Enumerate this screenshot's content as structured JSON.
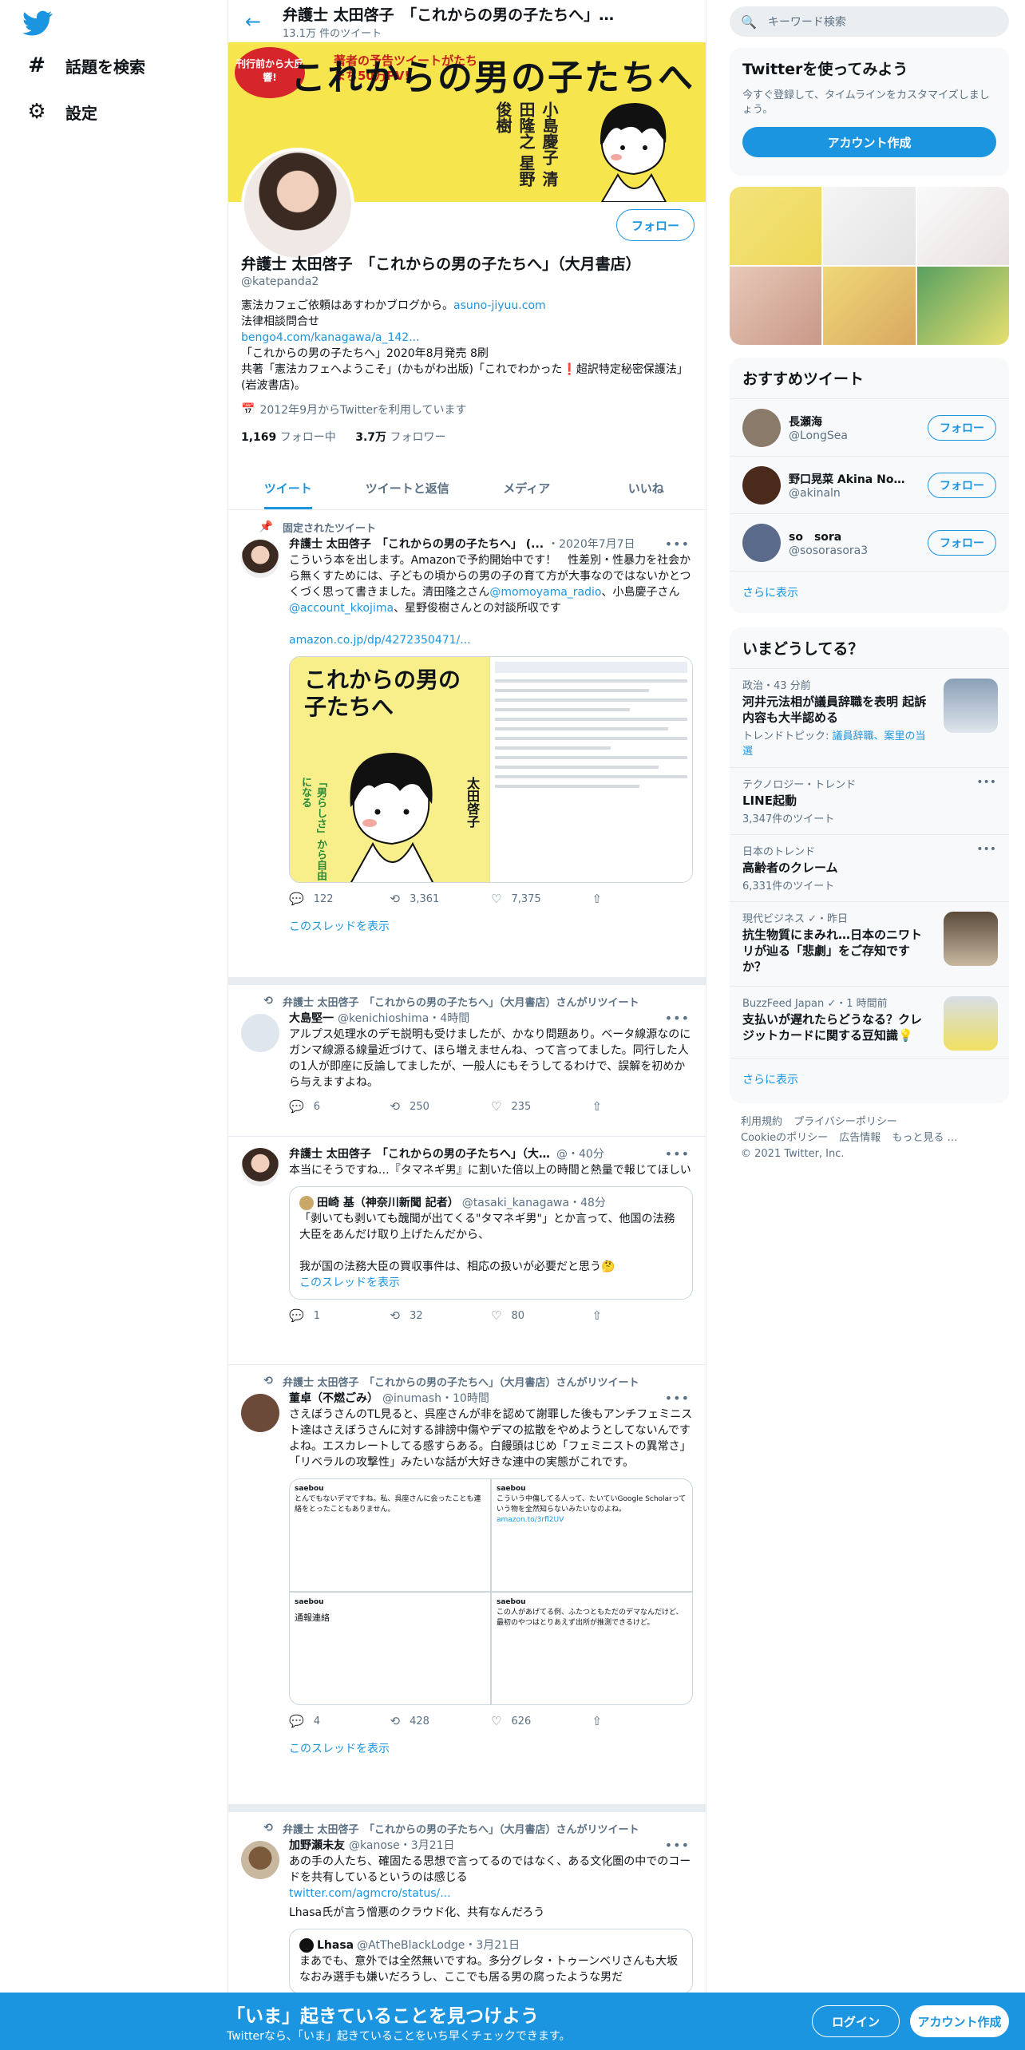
{
  "nav": {
    "explore_label": "話題を検索",
    "settings_label": "設定"
  },
  "header": {
    "title": "弁護士 太田啓子　「これからの男の子たちへ」…",
    "tweet_count": "13.1万 件のツイート"
  },
  "banner": {
    "badge": "刊行前から大反響!",
    "title": "これからの男の子たちへ",
    "promo": "著者の予告ツイートがたちまち50万PV!",
    "names": "小島慶子 清田隆之 星野俊樹"
  },
  "profile": {
    "follow_label": "フォロー",
    "name": "弁護士 太田啓子　「これからの男の子たちへ」（大月書店）",
    "handle": "@katepanda2",
    "bio_line1": "憲法カフェご依頼はあすわかブログから。",
    "bio_link1": "asuno-jiyuu.com",
    "bio_line2": "法律相談問合せ",
    "bio_link2": "bengo4.com/kanagawa/a_142...",
    "bio_line3": "「これからの男の子たちへ」2020年8月発売 8刷",
    "bio_line4": "共著「憲法カフェへようこそ」(かもがわ出版)「これでわかった❗超訳特定秘密保護法」(岩波書店)。",
    "joined": "2012年9月からTwitterを利用しています",
    "following_count": "1,169",
    "following_label": "フォロー中",
    "followers_count": "3.7万",
    "followers_label": "フォロワー"
  },
  "tabs": [
    "ツイート",
    "ツイートと返信",
    "メディア",
    "いいね"
  ],
  "tweets": [
    {
      "context": "固定されたツイート",
      "name": "弁護士 太田啓子　「これからの男の子たちへ」 (...",
      "handle": "・2020年7月7日",
      "text_a": "こういう本を出します。Amazonで予約開始中です！　性差別・性暴力を社会から無くすためには、子どもの頃からの男の子の育て方が大事なのではないかとつくづく思って書きました。清田隆之さん",
      "mention1": "@momoyama_radio",
      "text_b": "、小島慶子さん",
      "mention2": "@account_kkojima",
      "text_c": "、星野俊樹さんとの対談所収です",
      "link": "amazon.co.jp/dp/4272350471/...",
      "media_title": "これからの男の子たちへ",
      "media_author": "太田啓子",
      "media_side": "「男らしさ」から自由になる",
      "replies": "122",
      "retweets": "3,361",
      "likes": "7,375",
      "show_thread": "このスレッドを表示"
    },
    {
      "context": "弁護士 太田啓子　「これからの男の子たちへ」（大月書店）さんがリツイート",
      "name": "大島堅一",
      "handle": "@kenichioshima・4時間",
      "text": "アルプス処理水のデモ説明も受けましたが、かなり問題あり。ベータ線源なのにガンマ線源る線量近づけて、ほら増えませんね、って言ってました。同行した人の1人が即座に反論してましたが、一般人にもそうしてるわけで、誤解を初めから与えますよね。",
      "replies": "6",
      "retweets": "250",
      "likes": "235"
    },
    {
      "name": "弁護士 太田啓子　「これからの男の子たちへ」（大月書店）",
      "handle": "@・40分",
      "text": "本当にそうですね…『タマネギ男』に割いた倍以上の時間と熱量で報じてほしい",
      "quote_name": "田崎 基（神奈川新聞 記者）",
      "quote_handle": "@tasaki_kanagawa・48分",
      "quote_text1": "「剥いても剥いても醜聞が出てくる\"タマネギ男\"」とか言って、他国の法務大臣をあんだけ取り上げたんだから、",
      "quote_text2": "我が国の法務大臣の買収事件は、相応の扱いが必要だと思う🤔",
      "quote_thread": "このスレッドを表示",
      "replies": "1",
      "retweets": "32",
      "likes": "80"
    },
    {
      "context": "弁護士 太田啓子　「これからの男の子たちへ」（大月書店）さんがリツイート",
      "name": "董卓（不燃ごみ）",
      "handle": "@inumash・10時間",
      "text": "さえぼうさんのTL見ると、呉座さんが非を認めて謝罪した後もアンチフェミニスト達はさえぼうさんに対する誹謗中傷やデマの拡散をやめようとしてないんですよね。エスカレートしてる感すらある。白饅頭はじめ「フェミニストの異常さ」「リベラルの攻撃性」みたいな話が大好きな連中の実態がこれです。",
      "shot1_name": "saebou",
      "shot1_text": "とんでもないデマですね。私、呉座さんに会ったことも連絡をとったこともありません。",
      "shot2_name": "saebou",
      "shot2_text": "こういう中傷してる人って、たいていGoogle Scholarっていう物を全然知らないみたいなのよね。",
      "shot2_link": "amazon.to/3rfl2UV",
      "shot3_name": "saebou",
      "shot3_text": "通報連絡",
      "shot4_name": "saebou",
      "shot4_text": "この人があげてる例、ふたつともただのデマなんだけど、最初のやつはとりあえず出所が推測できるけど。",
      "replies": "4",
      "retweets": "428",
      "likes": "626",
      "show_thread": "このスレッドを表示"
    },
    {
      "context": "弁護士 太田啓子　「これからの男の子たちへ」（大月書店）さんがリツイート",
      "name": "加野瀬未友",
      "handle": "@kanose・3月21日",
      "text": "あの手の人たち、確固たる思想で言ってるのではなく、ある文化圏の中でのコードを共有しているというのは感じる",
      "link": "twitter.com/agmcro/status/...",
      "text2": "Lhasa氏が言う憎悪のクラウド化、共有なんだろう",
      "quote_name": "Lhasa",
      "quote_handle": "@AtTheBlackLodge・3月21日",
      "quote_text": "まあでも、意外では全然無いですね。多分グレタ・トゥーンベリさんも大坂なおみ選手も嫌いだろうし、ここでも居る男の腐ったような男だ"
    }
  ],
  "search": {
    "placeholder": "キーワード検索"
  },
  "signup": {
    "title": "Twitterを使ってみよう",
    "desc": "今すぐ登録して、タイムラインをカスタマイズしましょう。",
    "button": "アカウント作成"
  },
  "who_to_follow": {
    "title": "おすすめツイート",
    "items": [
      {
        "name": "長瀬海",
        "handle": "@LongSea",
        "button": "フォロー"
      },
      {
        "name": "野口晃菜 Akina Nog...",
        "handle": "@akinaln",
        "button": "フォロー"
      },
      {
        "name": "so　sora",
        "handle": "@sosorasora3",
        "button": "フォロー"
      }
    ],
    "more": "さらに表示"
  },
  "trends": {
    "title": "いまどうしてる？",
    "items": [
      {
        "top": "政治・43 分前",
        "title": "河井元法相が議員辞職を表明 起訴内容も大半認める",
        "bottom_prefix": "トレンドトピック: ",
        "bottom_link": "議員辞職、案里の当選"
      },
      {
        "top": "テクノロジー・トレンド",
        "title": "LINE起動",
        "bottom": "3,347件のツイート"
      },
      {
        "top": "日本のトレンド",
        "title": "高齢者のクレーム",
        "bottom": "6,331件のツイート"
      },
      {
        "top": "現代ビジネス ✓・昨日",
        "title": "抗生物質にまみれ…日本のニワトリが辿る「悲劇」をご存知ですか？"
      },
      {
        "top": "BuzzFeed Japan ✓・1 時間前",
        "title": "支払いが遅れたらどうなる？クレジットカードに関する豆知識💡"
      }
    ],
    "more": "さらに表示"
  },
  "footer": {
    "l1": "利用規約",
    "l2": "プライバシーポリシー",
    "l3": "Cookieのポリシー",
    "l4": "広告情報",
    "l5": "もっと見る …",
    "copy": "© 2021 Twitter, Inc."
  },
  "bottombar": {
    "headline": "「いま」起きていることを見つけよう",
    "sub": "Twitterなら、「いま」起きていることをいち早くチェックできます。",
    "login": "ログイン",
    "signup": "アカウント作成"
  },
  "colors": {
    "accent": "#1b95e0",
    "border": "#e6ecf0",
    "muted": "#5b7083"
  }
}
